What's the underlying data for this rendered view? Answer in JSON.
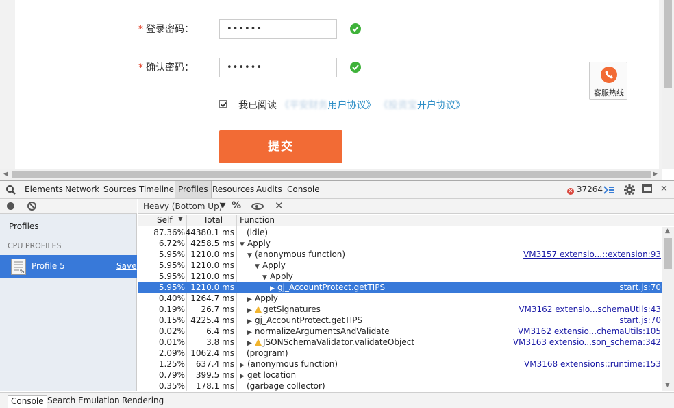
{
  "form": {
    "password_label": "登录密码：",
    "password_value": "••••••",
    "confirm_label": "确认密码：",
    "confirm_value": "••••••",
    "required_mark": "*",
    "agree_prefix": "我已阅读",
    "agree_link1_blur": "《平安财务",
    "agree_link1": "用户协议》",
    "agree_link2_blur": "《投资宝",
    "agree_link2": "开户协议》",
    "submit_label": "提交",
    "hotline_label": "客服热线"
  },
  "devtools": {
    "tabs": [
      "Elements",
      "Network",
      "Sources",
      "Timeline",
      "Profiles",
      "Resources",
      "Audits",
      "Console"
    ],
    "active_tab": "Profiles",
    "error_count": "37264",
    "sidebar": {
      "profiles_label": "Profiles",
      "cpu_profiles_label": "CPU PROFILES",
      "profile_name": "Profile 5",
      "save_label": "Save"
    },
    "toolbar": {
      "mode": "Heavy (Bottom Up)",
      "percent_icon": "%"
    },
    "columns": [
      "Self",
      "Total",
      "Function"
    ],
    "rows": [
      {
        "self": "87.36%",
        "total": "44380.1 ms",
        "fn": "(idle)",
        "arrow": "",
        "warn": false,
        "url": ""
      },
      {
        "self": "6.72%",
        "total": "4258.5 ms",
        "fn": "Apply",
        "arrow": "▼",
        "warn": false,
        "url": ""
      },
      {
        "self": "5.95%",
        "total": "1210.0 ms",
        "fn": "(anonymous function)",
        "arrow": "▼",
        "warn": false,
        "url": "VM3157 extensio...::extension:93"
      },
      {
        "self": "5.95%",
        "total": "1210.0 ms",
        "fn": "Apply",
        "arrow": "▼",
        "warn": false,
        "url": ""
      },
      {
        "self": "5.95%",
        "total": "1210.0 ms",
        "fn": "Apply",
        "arrow": "▼",
        "warn": false,
        "url": ""
      },
      {
        "self": "5.95%",
        "total": "1210.0 ms",
        "fn": "gj_AccountProtect.getTIPS",
        "arrow": "▶",
        "warn": false,
        "url": "start.js:70"
      },
      {
        "self": "0.40%",
        "total": "1264.7 ms",
        "fn": "Apply",
        "arrow": "▶",
        "warn": false,
        "url": ""
      },
      {
        "self": "0.19%",
        "total": "26.7 ms",
        "fn": "getSignatures",
        "arrow": "▶",
        "warn": true,
        "url": "VM3162 extensio...schemaUtils:43"
      },
      {
        "self": "0.15%",
        "total": "4225.4 ms",
        "fn": "gj_AccountProtect.getTIPS",
        "arrow": "▶",
        "warn": false,
        "url": "start.js:70"
      },
      {
        "self": "0.02%",
        "total": "6.4 ms",
        "fn": "normalizeArgumentsAndValidate",
        "arrow": "▶",
        "warn": false,
        "url": "VM3162 extensio...chemaUtils:105"
      },
      {
        "self": "0.01%",
        "total": "3.8 ms",
        "fn": "JSONSchemaValidator.validateObject",
        "arrow": "▶",
        "warn": true,
        "url": "VM3163 extensio...son_schema:342"
      },
      {
        "self": "2.09%",
        "total": "1062.4 ms",
        "fn": "(program)",
        "arrow": "",
        "warn": false,
        "url": ""
      },
      {
        "self": "1.25%",
        "total": "637.4 ms",
        "fn": "(anonymous function)",
        "arrow": "▶",
        "warn": false,
        "url": "VM3168 extensions::runtime:153"
      },
      {
        "self": "0.79%",
        "total": "399.5 ms",
        "fn": "get location",
        "arrow": "▶",
        "warn": false,
        "url": ""
      },
      {
        "self": "0.35%",
        "total": "178.1 ms",
        "fn": "(garbage collector)",
        "arrow": "",
        "warn": false,
        "url": ""
      }
    ],
    "selected_row": 5,
    "drawer_tabs": [
      "Console",
      "Search",
      "Emulation",
      "Rendering"
    ],
    "active_drawer_tab": "Console"
  }
}
